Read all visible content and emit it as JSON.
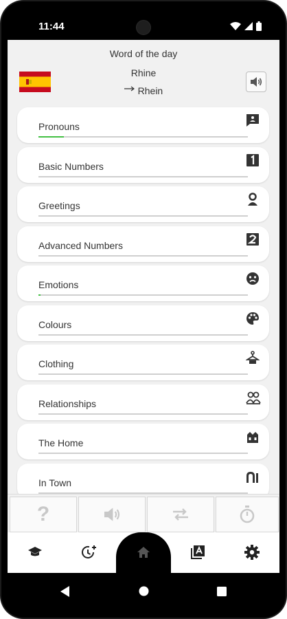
{
  "status": {
    "time": "11:44",
    "icons": [
      "wifi-icon",
      "signal-icon",
      "battery-icon"
    ]
  },
  "word_of_day": {
    "title": "Word of the day",
    "word": "Rhine",
    "translation": "Rhein",
    "flag": "spain-flag",
    "speaker_icon": "speaker-icon"
  },
  "topics": [
    {
      "label": "Pronouns",
      "progress": 0.12,
      "icon": "chat-bubble-icon"
    },
    {
      "label": "Basic Numbers",
      "progress": 0,
      "icon": "number-one-icon"
    },
    {
      "label": "Greetings",
      "progress": 0,
      "icon": "waving-person-icon"
    },
    {
      "label": "Advanced Numbers",
      "progress": 0,
      "icon": "number-two-icon"
    },
    {
      "label": "Emotions",
      "progress": 0.01,
      "icon": "sad-face-icon"
    },
    {
      "label": "Colours",
      "progress": 0,
      "icon": "palette-icon"
    },
    {
      "label": "Clothing",
      "progress": 0,
      "icon": "hanger-icon"
    },
    {
      "label": "Relationships",
      "progress": 0,
      "icon": "people-icon"
    },
    {
      "label": "The Home",
      "progress": 0,
      "icon": "house-icon"
    },
    {
      "label": "In Town",
      "progress": 0,
      "icon": "buildings-icon"
    }
  ],
  "actions": [
    {
      "icon": "question-mark-icon",
      "label": "?"
    },
    {
      "icon": "speaker-icon"
    },
    {
      "icon": "swap-arrows-icon"
    },
    {
      "icon": "stopwatch-icon"
    }
  ],
  "bottom_nav": [
    {
      "icon": "graduation-cap-icon"
    },
    {
      "icon": "clock-plus-icon"
    },
    {
      "icon": "home-icon",
      "active": true
    },
    {
      "icon": "dictionary-icon"
    },
    {
      "icon": "gear-icon"
    }
  ],
  "colors": {
    "progress": "#43c043",
    "track": "#cfcfcf",
    "background": "#f1f1f1",
    "flag_red": "#c60b1e",
    "flag_yellow": "#ffc400"
  }
}
